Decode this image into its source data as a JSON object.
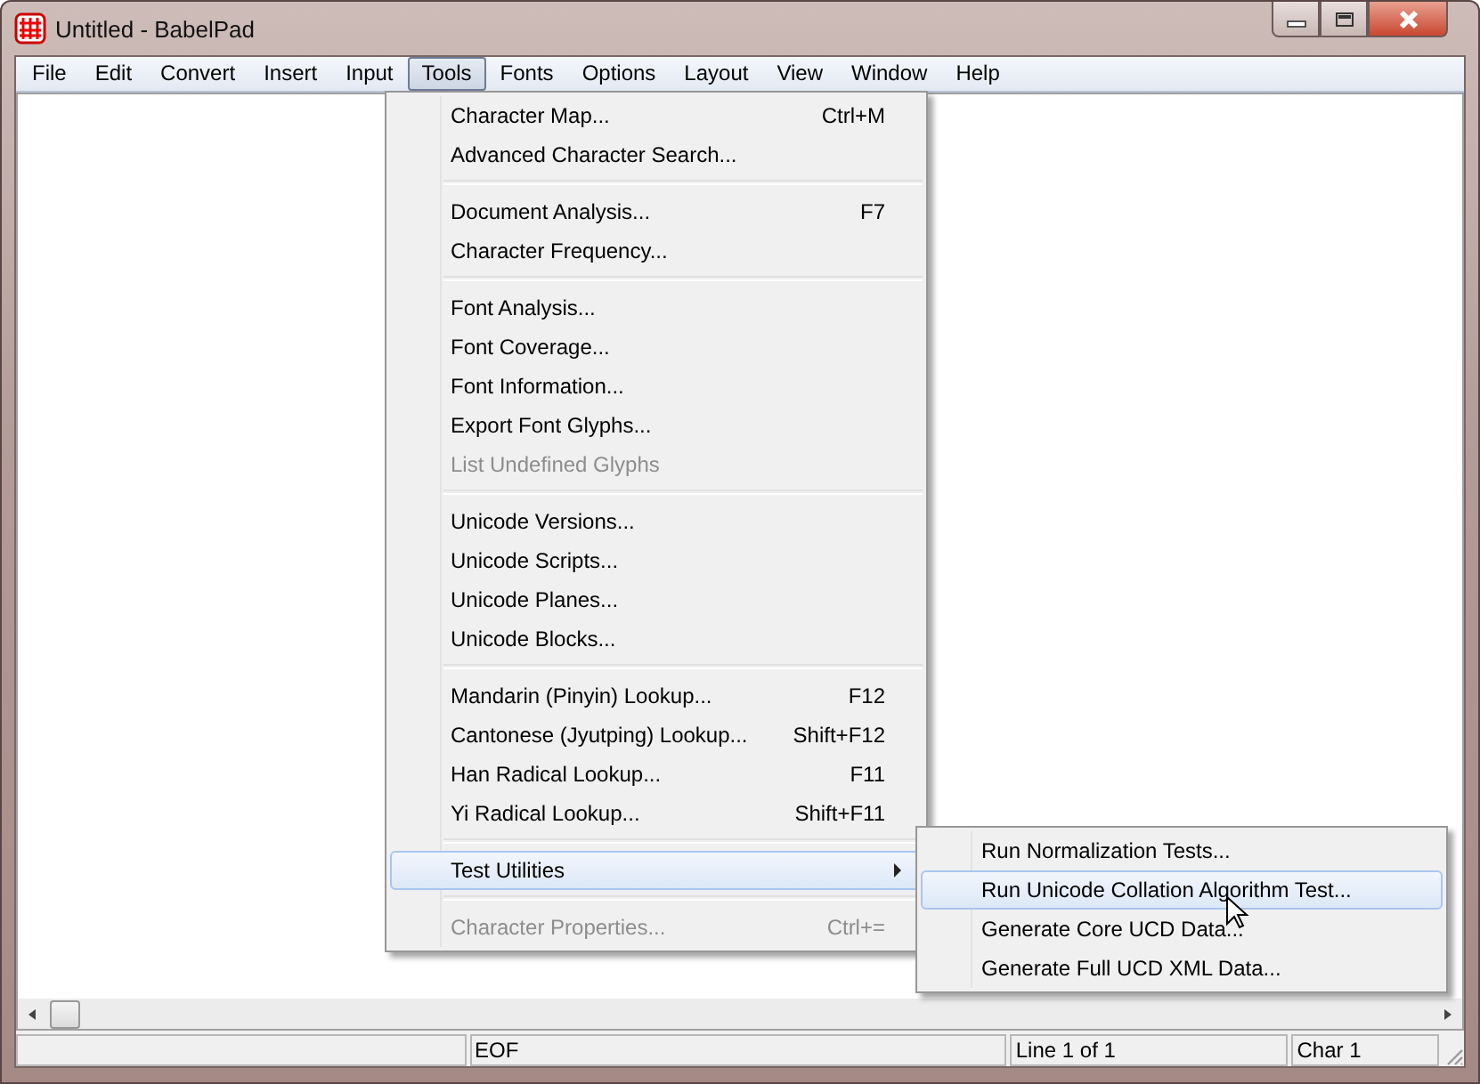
{
  "window": {
    "title": "Untitled - BabelPad"
  },
  "menubar": [
    {
      "label": "File",
      "selected": false
    },
    {
      "label": "Edit",
      "selected": false
    },
    {
      "label": "Convert",
      "selected": false
    },
    {
      "label": "Insert",
      "selected": false
    },
    {
      "label": "Input",
      "selected": false
    },
    {
      "label": "Tools",
      "selected": true
    },
    {
      "label": "Fonts",
      "selected": false
    },
    {
      "label": "Options",
      "selected": false
    },
    {
      "label": "Layout",
      "selected": false
    },
    {
      "label": "View",
      "selected": false
    },
    {
      "label": "Window",
      "selected": false
    },
    {
      "label": "Help",
      "selected": false
    }
  ],
  "tools_menu": [
    [
      {
        "label": "Character Map...",
        "shortcut": "Ctrl+M",
        "disabled": false,
        "selected": false
      },
      {
        "label": "Advanced Character Search...",
        "disabled": false,
        "selected": false
      }
    ],
    [
      {
        "label": "Document Analysis...",
        "shortcut": "F7",
        "disabled": false,
        "selected": false
      },
      {
        "label": "Character Frequency...",
        "disabled": false,
        "selected": false
      }
    ],
    [
      {
        "label": "Font Analysis...",
        "disabled": false,
        "selected": false
      },
      {
        "label": "Font Coverage...",
        "disabled": false,
        "selected": false
      },
      {
        "label": "Font Information...",
        "disabled": false,
        "selected": false
      },
      {
        "label": "Export Font Glyphs...",
        "disabled": false,
        "selected": false
      },
      {
        "label": "List Undefined Glyphs",
        "disabled": true,
        "selected": false
      }
    ],
    [
      {
        "label": "Unicode Versions...",
        "disabled": false,
        "selected": false
      },
      {
        "label": "Unicode Scripts...",
        "disabled": false,
        "selected": false
      },
      {
        "label": "Unicode Planes...",
        "disabled": false,
        "selected": false
      },
      {
        "label": "Unicode Blocks...",
        "disabled": false,
        "selected": false
      }
    ],
    [
      {
        "label": "Mandarin (Pinyin) Lookup...",
        "shortcut": "F12",
        "disabled": false,
        "selected": false
      },
      {
        "label": "Cantonese (Jyutping) Lookup...",
        "shortcut": "Shift+F12",
        "disabled": false,
        "selected": false
      },
      {
        "label": "Han Radical Lookup...",
        "shortcut": "F11",
        "disabled": false,
        "selected": false
      },
      {
        "label": "Yi Radical Lookup...",
        "shortcut": "Shift+F11",
        "disabled": false,
        "selected": false
      }
    ],
    [
      {
        "label": "Test Utilities",
        "submenu": true,
        "disabled": false,
        "selected": true
      }
    ],
    [
      {
        "label": "Character Properties...",
        "shortcut": "Ctrl+=",
        "disabled": true,
        "selected": false
      }
    ]
  ],
  "test_utilities_submenu": [
    {
      "label": "Run Normalization Tests...",
      "selected": false
    },
    {
      "label": "Run Unicode Collation Algorithm Test...",
      "selected": true
    },
    {
      "label": "Generate Core UCD Data...",
      "selected": false
    },
    {
      "label": "Generate Full UCD XML Data...",
      "selected": false
    }
  ],
  "status_bar": [
    "EOF",
    "Line 1 of 1",
    "Char 1"
  ]
}
